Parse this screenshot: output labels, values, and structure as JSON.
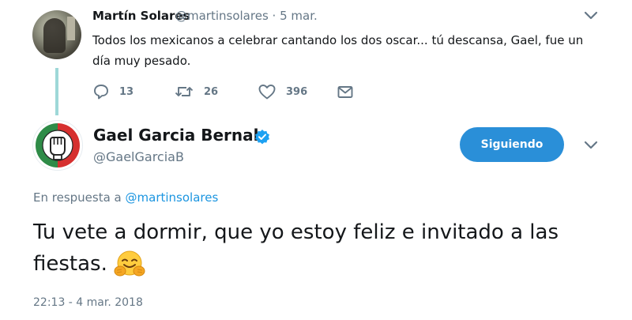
{
  "parent_tweet": {
    "author_name": "Martín Solares",
    "author_handle": "@martinsolares",
    "separator": "·",
    "date": "5 mar.",
    "text": "Todos los mexicanos a celebrar cantando los dos oscar... tú descansa, Gael, fue un día muy pesado.",
    "reply_count": "13",
    "retweet_count": "26",
    "like_count": "396"
  },
  "main_tweet": {
    "author_name": "Gael Garcia Bernal",
    "author_handle": "@GaelGarciaB",
    "follow_button_label": "Siguiendo",
    "reply_prefix": "En respuesta a",
    "reply_mention": "@martinsolares",
    "text": "Tu vete a dormir, que yo estoy feliz e invitado a las fiestas.",
    "emoji": "hugging-face",
    "timestamp": "22:13 - 4 mar. 2018"
  },
  "colors": {
    "link_blue": "#1b95e0",
    "button_blue": "#2a8fd8",
    "muted_gray": "#657786",
    "thread_line": "#9ed8d8",
    "verified_blue": "#1da1f2"
  }
}
